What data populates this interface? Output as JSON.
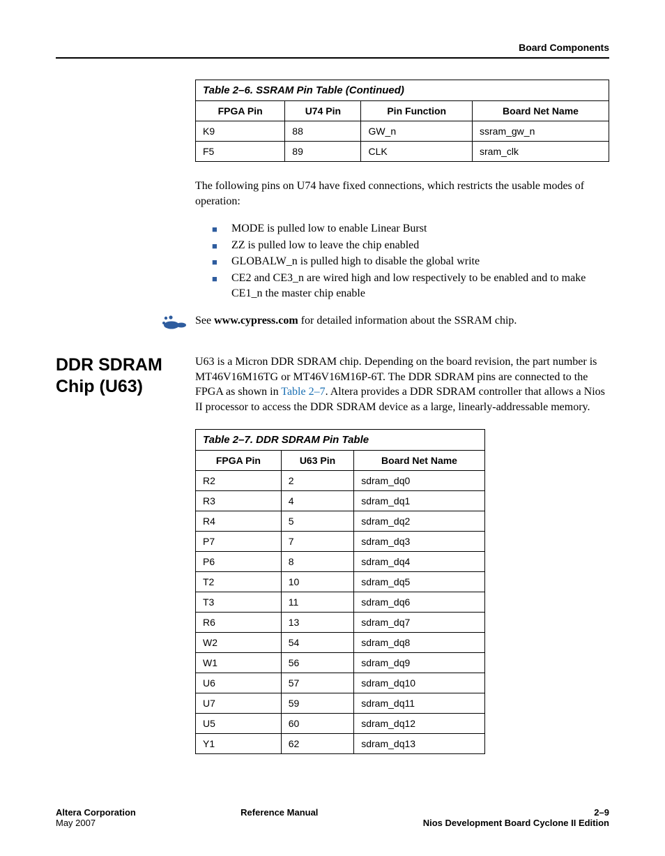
{
  "header": {
    "breadcrumb": "Board Components"
  },
  "table26": {
    "title": "Table 2–6. SSRAM Pin Table (Continued)",
    "columns": [
      "FPGA Pin",
      "U74 Pin",
      "Pin Function",
      "Board Net Name"
    ],
    "rows": [
      [
        "K9",
        "88",
        "GW_n",
        "ssram_gw_n"
      ],
      [
        "F5",
        "89",
        "CLK",
        "sram_clk"
      ]
    ]
  },
  "para1": "The following pins on U74 have fixed connections, which restricts the usable modes of operation:",
  "bullets": [
    "MODE is pulled low to enable Linear Burst",
    "ZZ is pulled low to leave the chip enabled",
    "GLOBALW_n is pulled high to disable the global write",
    "CE2 and CE3_n are wired high and low respectively to be enabled and to make CE1_n the master chip enable"
  ],
  "linkline": {
    "prefix": "See ",
    "bold": "www.cypress.com",
    "suffix": " for detailed information about the SSRAM chip."
  },
  "section": {
    "heading": "DDR SDRAM Chip (U63)",
    "body_prefix": "U63 is a Micron DDR SDRAM chip. Depending on the board revision, the part number is MT46V16M16TG or MT46V16M16P-6T. The DDR SDRAM pins are connected to the FPGA as shown in ",
    "body_link": "Table 2–7",
    "body_suffix": ". Altera provides a DDR SDRAM controller that allows a Nios II processor to access the DDR SDRAM device as a large, linearly-addressable memory."
  },
  "table27": {
    "title": "Table 2–7. DDR SDRAM Pin Table",
    "columns": [
      "FPGA Pin",
      "U63 Pin",
      "Board Net Name"
    ],
    "rows": [
      [
        "R2",
        "2",
        "sdram_dq0"
      ],
      [
        "R3",
        "4",
        "sdram_dq1"
      ],
      [
        "R4",
        "5",
        "sdram_dq2"
      ],
      [
        "P7",
        "7",
        "sdram_dq3"
      ],
      [
        "P6",
        "8",
        "sdram_dq4"
      ],
      [
        "T2",
        "10",
        "sdram_dq5"
      ],
      [
        "T3",
        "11",
        "sdram_dq6"
      ],
      [
        "R6",
        "13",
        "sdram_dq7"
      ],
      [
        "W2",
        "54",
        "sdram_dq8"
      ],
      [
        "W1",
        "56",
        "sdram_dq9"
      ],
      [
        "U6",
        "57",
        "sdram_dq10"
      ],
      [
        "U7",
        "59",
        "sdram_dq11"
      ],
      [
        "U5",
        "60",
        "sdram_dq12"
      ],
      [
        "Y1",
        "62",
        "sdram_dq13"
      ]
    ]
  },
  "footer": {
    "left_line1": "Altera Corporation",
    "left_line2": "May 2007",
    "center": "Reference Manual",
    "right_line1": "2–9",
    "right_line2": "Nios Development Board Cyclone II Edition"
  }
}
